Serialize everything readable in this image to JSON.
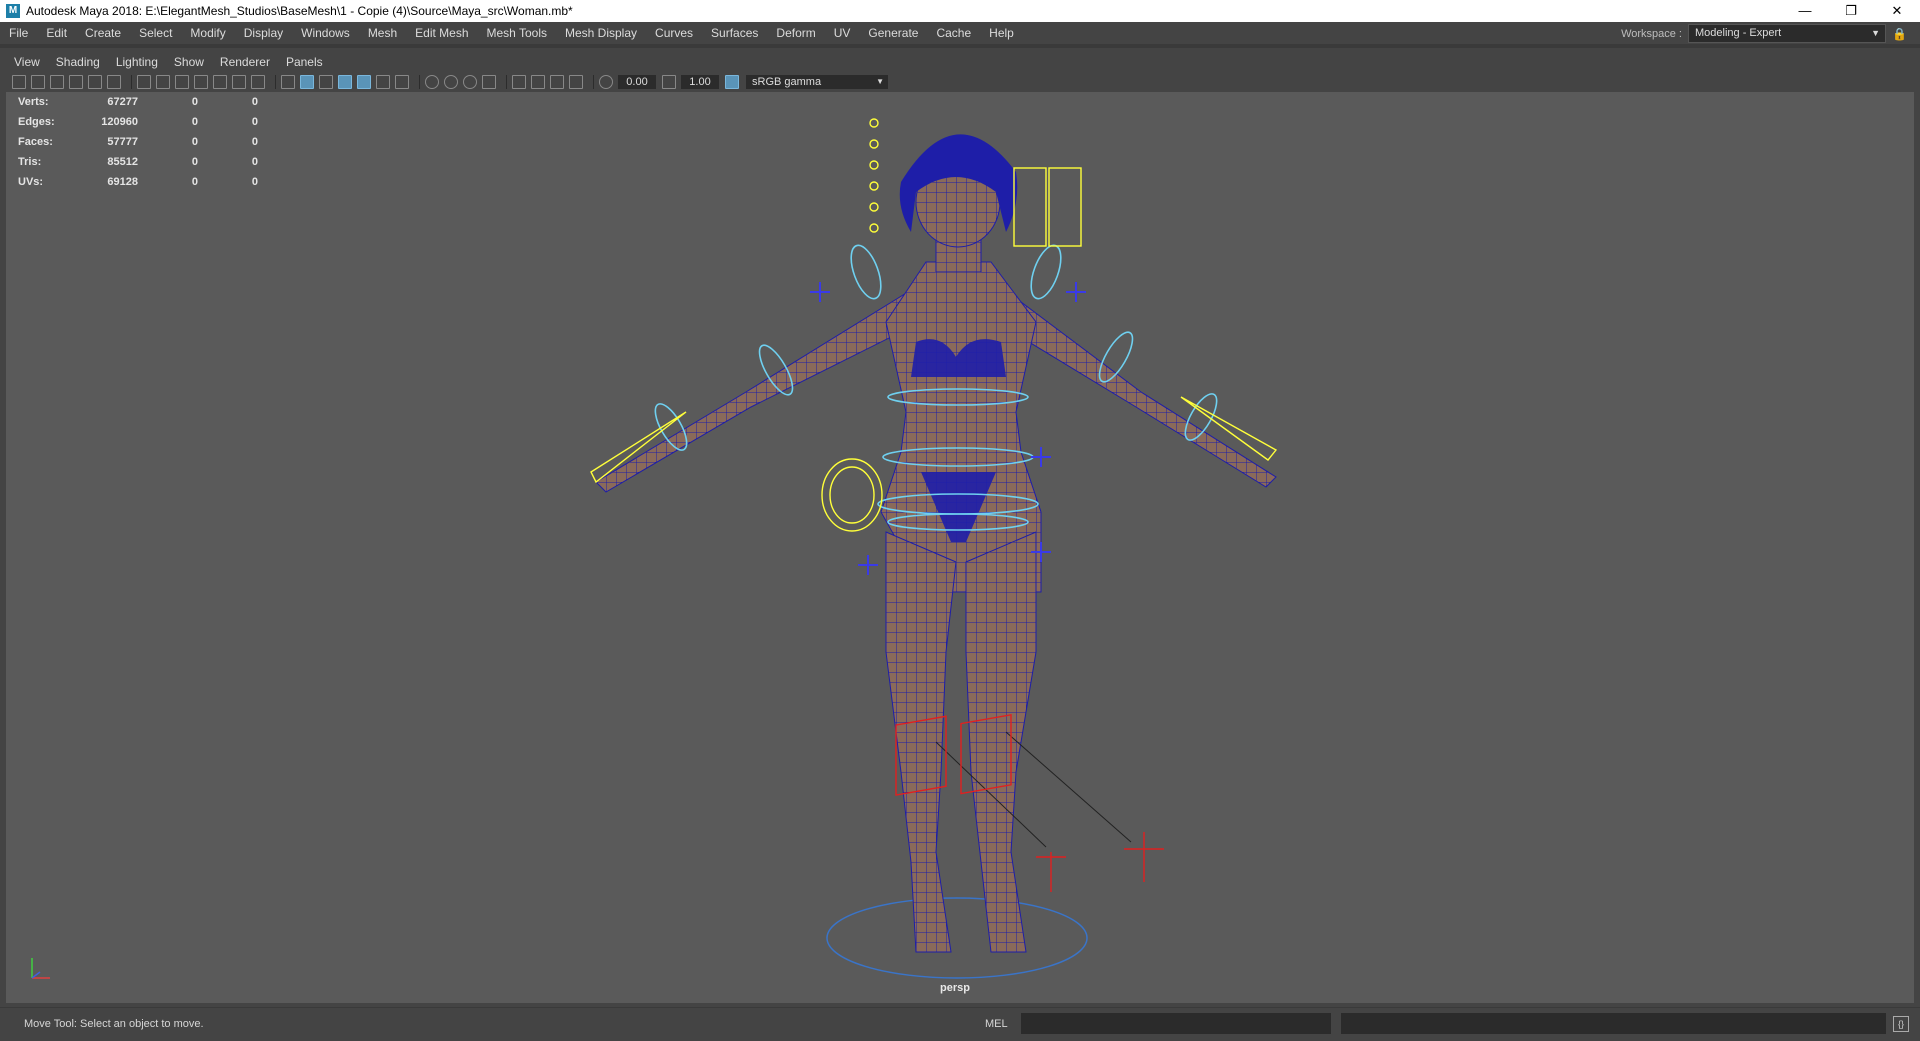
{
  "window": {
    "app_icon": "maya-icon",
    "title": "Autodesk Maya 2018: E:\\ElegantMesh_Studios\\BaseMesh\\1 - Copie (4)\\Source\\Maya_src\\Woman.mb*",
    "controls": [
      "minimize-icon",
      "restore-icon",
      "close-icon"
    ]
  },
  "menubar": {
    "items": [
      "File",
      "Edit",
      "Create",
      "Select",
      "Modify",
      "Display",
      "Windows",
      "Mesh",
      "Edit Mesh",
      "Mesh Tools",
      "Mesh Display",
      "Curves",
      "Surfaces",
      "Deform",
      "UV",
      "Generate",
      "Cache",
      "Help"
    ],
    "workspace_label": "Workspace :",
    "workspace_value": "Modeling - Expert"
  },
  "panel_menu": {
    "items": [
      "View",
      "Shading",
      "Lighting",
      "Show",
      "Renderer",
      "Panels"
    ]
  },
  "panel_toolbar": {
    "exposure": "0.00",
    "gamma": "1.00",
    "color_space": "sRGB gamma"
  },
  "hud": {
    "rows": [
      {
        "label": "Verts:",
        "value": "67277",
        "selected": "0",
        "component": "0"
      },
      {
        "label": "Edges:",
        "value": "120960",
        "selected": "0",
        "component": "0"
      },
      {
        "label": "Faces:",
        "value": "57777",
        "selected": "0",
        "component": "0"
      },
      {
        "label": "Tris:",
        "value": "85512",
        "selected": "0",
        "component": "0"
      },
      {
        "label": "UVs:",
        "value": "69128",
        "selected": "0",
        "component": "0"
      }
    ]
  },
  "viewport": {
    "camera": "persp",
    "colors": {
      "background": "#5a5a5a",
      "wireframe": "#1e1ea8",
      "skin": "#8a6a5a",
      "controller_cyan": "#6fd0f0",
      "controller_yellow": "#ffff3a",
      "ik_red": "#e02020"
    }
  },
  "command_line": {
    "help_text": "Move Tool: Select an object to move.",
    "language": "MEL"
  }
}
